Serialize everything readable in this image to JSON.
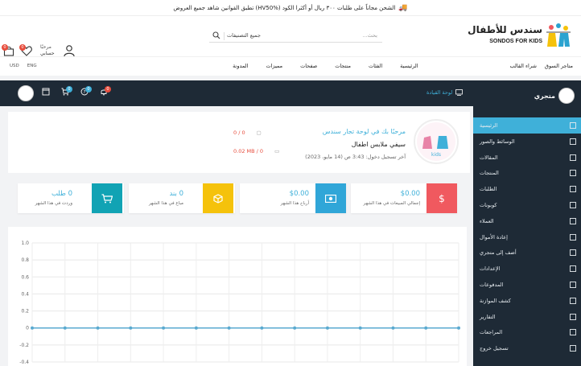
{
  "announcement": {
    "text": "الشحن مجاناً على طلبات ٣٠٠ ريال أو أكثرا الكود (HV50%) تطبق القوانين شاهد جميع العروض",
    "icon": "truck-icon"
  },
  "header": {
    "logo_ar": "سندس للأطفال",
    "logo_en": "SONDOS FOR KIDS",
    "search_placeholder": "بحث...",
    "search_category": "جميع التصنيفات",
    "greeting": "مرحبًا",
    "username": "حسابي",
    "cart_count": "0",
    "wishlist_count": "0"
  },
  "nav": {
    "links": [
      "الرئيسية",
      "الفئات",
      "منتجات",
      "صفحات",
      "مميزات",
      "المدونة",
      "شراء القالب",
      "متاجر السوق"
    ],
    "lang": "ENG",
    "currency": "USD"
  },
  "adminbar": {
    "brand": "متجري",
    "dashboard_label": "لوحة القيادة",
    "notif_count": "0",
    "help_count": "0",
    "cart_count": "0"
  },
  "sidebar": {
    "items": [
      {
        "label": "الرئيسية",
        "icon": "dashboard-icon",
        "active": true
      },
      {
        "label": "الوسائط والصور",
        "icon": "image-icon"
      },
      {
        "label": "المقالات",
        "icon": "article-icon"
      },
      {
        "label": "المنتجات",
        "icon": "box-icon"
      },
      {
        "label": "الطلبات",
        "icon": "cart-icon"
      },
      {
        "label": "كوبونات",
        "icon": "coupon-icon"
      },
      {
        "label": "العملاء",
        "icon": "users-icon"
      },
      {
        "label": "إعادة الأموال",
        "icon": "refund-icon"
      },
      {
        "label": "أضف إلى متجري",
        "icon": "add-icon"
      },
      {
        "label": "الإعدادات",
        "icon": "gear-icon"
      },
      {
        "label": "المدفوعات",
        "icon": "payment-icon"
      },
      {
        "label": "كشف الموازنة",
        "icon": "statement-icon"
      },
      {
        "label": "التقارير",
        "icon": "report-icon"
      },
      {
        "label": "المراجعات",
        "icon": "review-icon"
      },
      {
        "label": "تسجيل خروج",
        "icon": "logout-icon"
      }
    ]
  },
  "welcome": {
    "title": "مرحبًا بك في لوحة تجار سندس",
    "store_name": "سيفي ملابس اطفال",
    "last_login": "آخر تسجيل دخول: 3:43 ص (14 مايو، 2023)",
    "stat_orders": "0 / 0",
    "stat_space": "0.02 MB / 0"
  },
  "cards": [
    {
      "value": "$0.00",
      "sub": "إجمالي المبيعات في هذا الشهر",
      "color": "#f0595f",
      "icon": "dollar-icon"
    },
    {
      "value": "$0.00",
      "sub": "أرباح هذا الشهر",
      "color": "#30a6d8",
      "icon": "money-icon"
    },
    {
      "value": "0 بند",
      "sub": "مباع في هذا الشهر",
      "color": "#f5c20b",
      "icon": "cube-icon"
    },
    {
      "value": "0 طلب",
      "sub": "وردت في هذا الشهر",
      "color": "#11a3b4",
      "icon": "cart-icon"
    }
  ],
  "chart_data": {
    "type": "line",
    "ylim": [
      -0.4,
      1.0
    ],
    "yticks": [
      "1.0",
      "0.8",
      "0.6",
      "0.4",
      "0.2",
      "0",
      "-0.2",
      "-0.4"
    ],
    "series": [
      {
        "values": [
          0,
          0,
          0,
          0,
          0,
          0,
          0,
          0,
          0,
          0,
          0,
          0,
          0,
          0
        ]
      }
    ],
    "grid": true,
    "color": "#5aaad0"
  }
}
